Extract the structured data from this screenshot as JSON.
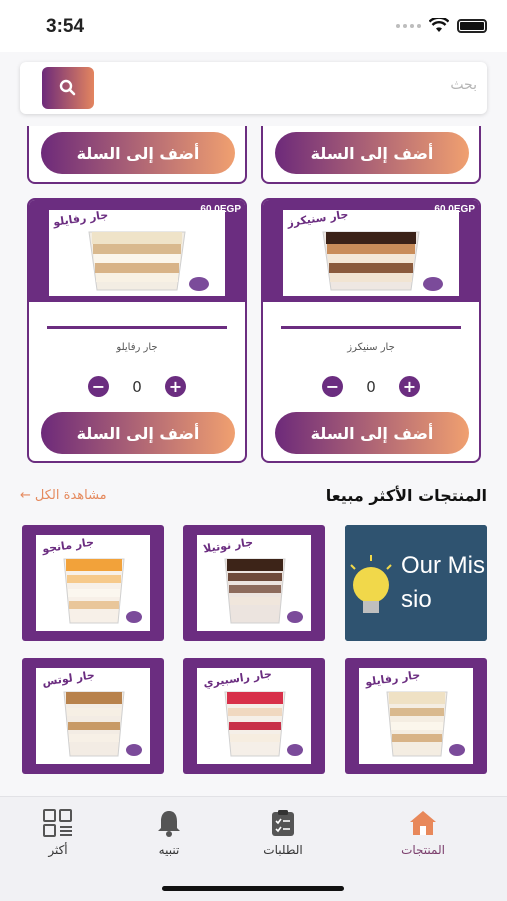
{
  "status": {
    "time": "3:54"
  },
  "search": {
    "placeholder": "بحث"
  },
  "cards_top": [
    {
      "add_label": "أضف إلى السلة"
    },
    {
      "add_label": "أضف إلى السلة"
    }
  ],
  "cards": [
    {
      "name": "جار سنيكرز",
      "price": "60.0EGP",
      "qty": "0",
      "add_label": "أضف إلى السلة",
      "img_label": "جار سنيكرز"
    },
    {
      "name": "جار رفايلو",
      "price": "60.0EGP",
      "qty": "0",
      "add_label": "أضف إلى السلة",
      "img_label": "جار رفايلو"
    }
  ],
  "best_sellers": {
    "title": "المنتجات الأكثر مبيعا",
    "see_all": "مشاهدة الكل",
    "mission_text": "Our Missio",
    "tiles": [
      {
        "label": "جار مانجو"
      },
      {
        "label": "جار نوتيلا"
      },
      {
        "label": "جار لوتس"
      },
      {
        "label": "جار راسبيري"
      },
      {
        "label": "جار رفايلو"
      }
    ]
  },
  "tabs": [
    {
      "label": "المنتجات",
      "icon": "home-icon",
      "active": true
    },
    {
      "label": "الطلبات",
      "icon": "clipboard-icon",
      "active": false
    },
    {
      "label": "تنبيه",
      "icon": "bell-icon",
      "active": false
    },
    {
      "label": "أكثر",
      "icon": "grid-icon",
      "active": false
    }
  ],
  "colors": {
    "primary": "#6b2d80",
    "accent": "#e58a5e"
  }
}
